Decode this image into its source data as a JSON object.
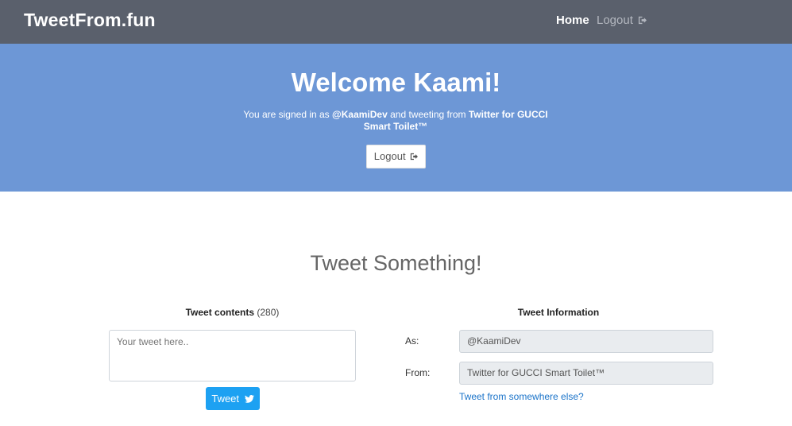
{
  "navbar": {
    "brand": "TweetFrom.fun",
    "home_label": "Home",
    "logout_label": "Logout"
  },
  "jumbotron": {
    "title": "Welcome Kaami!",
    "text_signed_in": "You are signed in as",
    "handle": "@KaamiDev",
    "text_tweeting_from": "and tweeting from",
    "client": "Twitter for GUCCI Smart Toilet™",
    "logout_button": "Logout"
  },
  "main": {
    "title": "Tweet Something!",
    "tweet_contents_label": "Tweet contents",
    "tweet_count": "(280)",
    "tweet_placeholder": "Your tweet here..",
    "tweet_button": "Tweet",
    "info_label": "Tweet Information",
    "as_label": "As:",
    "as_value": "@KaamiDev",
    "from_label": "From:",
    "from_value": "Twitter for GUCCI Smart Toilet™",
    "elsewhere_link": "Tweet from somewhere else?"
  },
  "colors": {
    "navbar": "#5a606c",
    "jumbotron": "#6d97d6",
    "tweet_button": "#1da1f2",
    "link": "#1a73c9"
  }
}
